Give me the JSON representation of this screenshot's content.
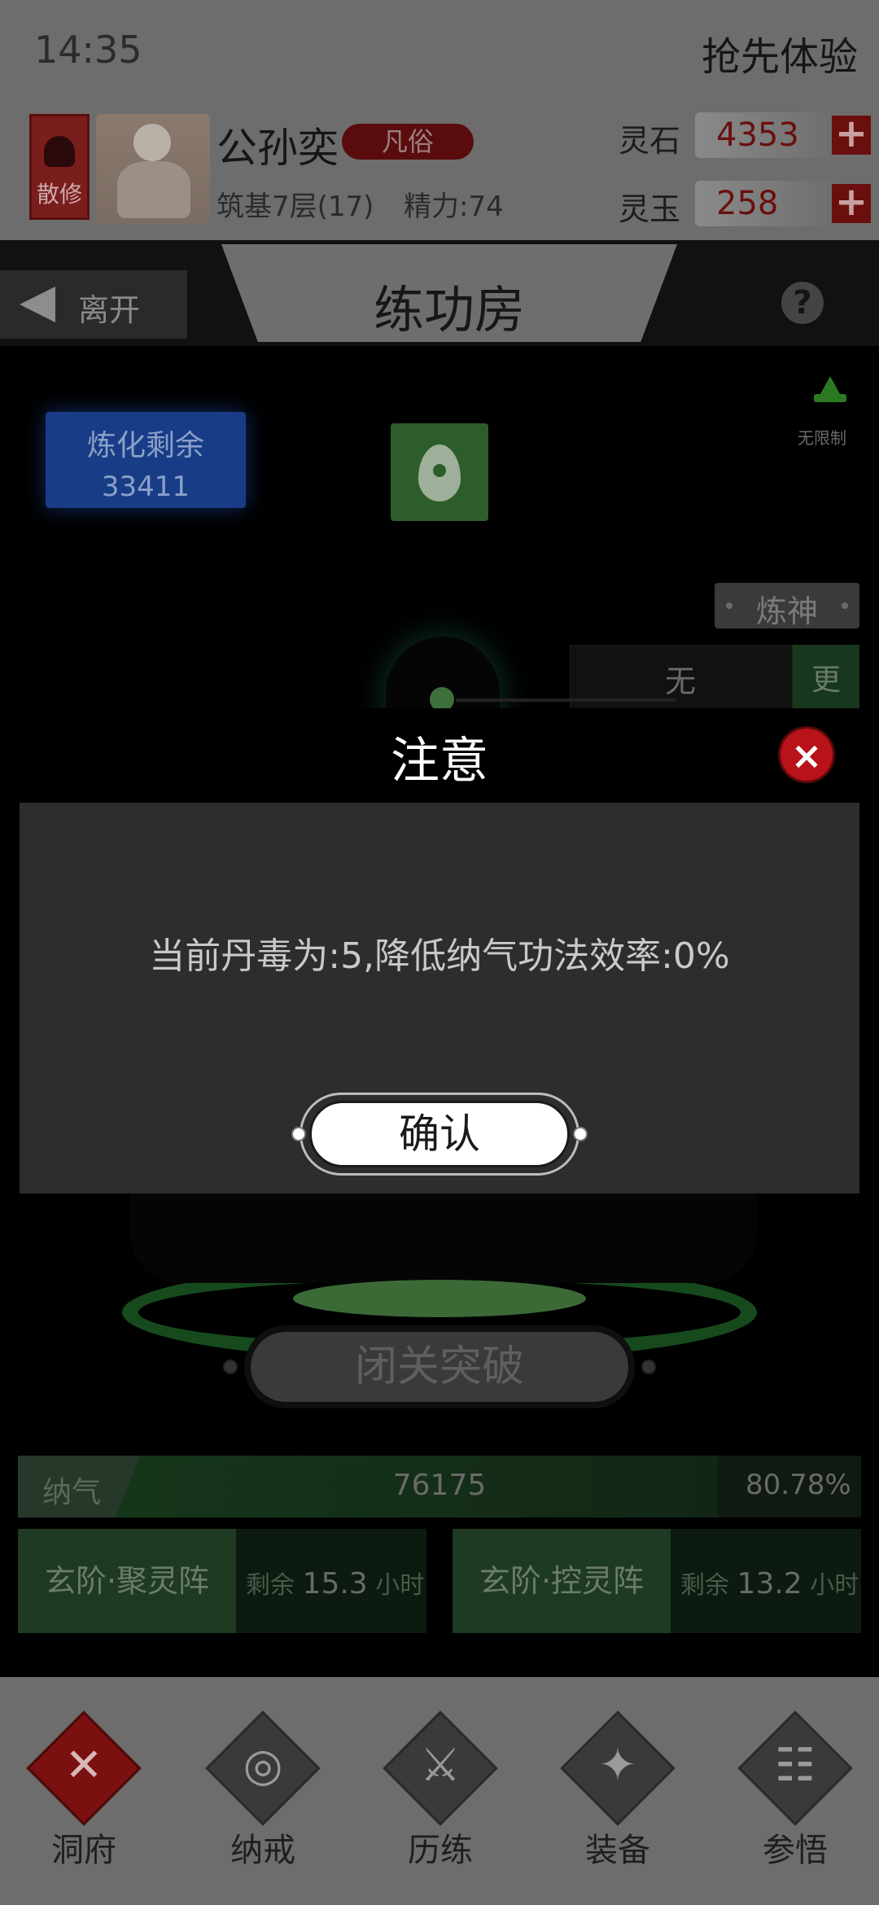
{
  "status_bar": {
    "time": "14:35",
    "preview_label": "抢先体验"
  },
  "profile": {
    "sect": "散修",
    "name": "公孙奕",
    "rank": "凡俗",
    "realm": "筑基7层(17)",
    "energy": "精力:74"
  },
  "currency": {
    "stone_label": "灵石",
    "stone_value": "4353",
    "jade_label": "灵玉",
    "jade_value": "258",
    "plus": "+"
  },
  "title_bar": {
    "leave_label": "离开",
    "title": "练功房",
    "help": "?"
  },
  "main": {
    "refine_label": "炼化剩余",
    "refine_value": "33411",
    "unlimited_label": "无限制",
    "refine_god_label": "炼神",
    "method_value": "无",
    "more_label": "更",
    "breakthrough_label": "闭关突破"
  },
  "modal": {
    "title": "注意",
    "message": "当前丹毒为:5,降低纳气功法效率:0%",
    "confirm_label": "确认",
    "close_icon": "×"
  },
  "qi": {
    "label": "纳气",
    "value": "76175",
    "percent": "80.78%"
  },
  "arrays": [
    {
      "name": "玄阶·聚灵阵",
      "remain_prefix": "剩余",
      "remain_value": "15.3",
      "remain_unit": "小时"
    },
    {
      "name": "玄阶·控灵阵",
      "remain_prefix": "剩余",
      "remain_value": "13.2",
      "remain_unit": "小时"
    }
  ],
  "nav": [
    {
      "label": "洞府",
      "icon": "cross-icon",
      "glyph": "✕"
    },
    {
      "label": "纳戒",
      "icon": "ring-icon",
      "glyph": "◎"
    },
    {
      "label": "历练",
      "icon": "swords-icon",
      "glyph": "⚔"
    },
    {
      "label": "装备",
      "icon": "sword-icon",
      "glyph": "✦"
    },
    {
      "label": "参悟",
      "icon": "book-icon",
      "glyph": "☷"
    }
  ]
}
